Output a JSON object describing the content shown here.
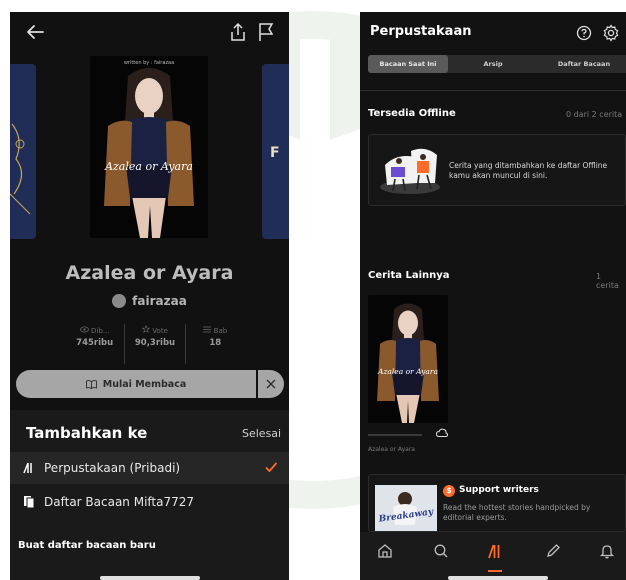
{
  "left_screen": {
    "cover": {
      "byline": "written by : fairazaa",
      "title": "Azalea or Ayara",
      "right_fragment": "F"
    },
    "book_title": "Azalea or Ayara",
    "author": "fairazaa",
    "stats": [
      {
        "label": "Dib...",
        "value": "745ribu",
        "icon": "eye-icon"
      },
      {
        "label": "Vote",
        "value": "90,3ribu",
        "icon": "star-icon"
      },
      {
        "label": "Bab",
        "value": "18",
        "icon": "list-icon"
      }
    ],
    "read_button": "Mulai Membaca",
    "sheet": {
      "heading": "Tambahkan ke",
      "done": "Selesai",
      "items": [
        {
          "label": "Perpustakaan (Pribadi)",
          "selected": true,
          "icon": "library-icon"
        },
        {
          "label": "Daftar Bacaan Mifta7727",
          "selected": false,
          "icon": "reading-list-icon"
        }
      ],
      "new_list": "Buat daftar bacaan baru"
    }
  },
  "right_screen": {
    "title": "Perpustakaan",
    "tabs": [
      {
        "label": "Bacaan Saat Ini",
        "active": true
      },
      {
        "label": "Arsip",
        "active": false
      },
      {
        "label": "Daftar Bacaan",
        "active": false
      }
    ],
    "offline": {
      "title": "Tersedia Offline",
      "count": "0 dari 2 cerita",
      "message": "Cerita yang ditambahkan ke daftar Offline kamu akan muncul di sini."
    },
    "others": {
      "title": "Cerita Lainnya",
      "count": "1 cerita",
      "book_title": "Azalea or Ayara",
      "book_name": "Azalea or Ayara"
    },
    "support": {
      "badge": "$",
      "title": "Support writers",
      "description": "Read the hottest stories handpicked by editorial experts.",
      "image_word": "Breakaway"
    },
    "nav": [
      "home-icon",
      "search-icon",
      "library-icon",
      "write-icon",
      "notification-icon"
    ]
  },
  "colors": {
    "accent": "#ff6b2b",
    "background": "#121212",
    "cover_side": "#1f2d57"
  }
}
